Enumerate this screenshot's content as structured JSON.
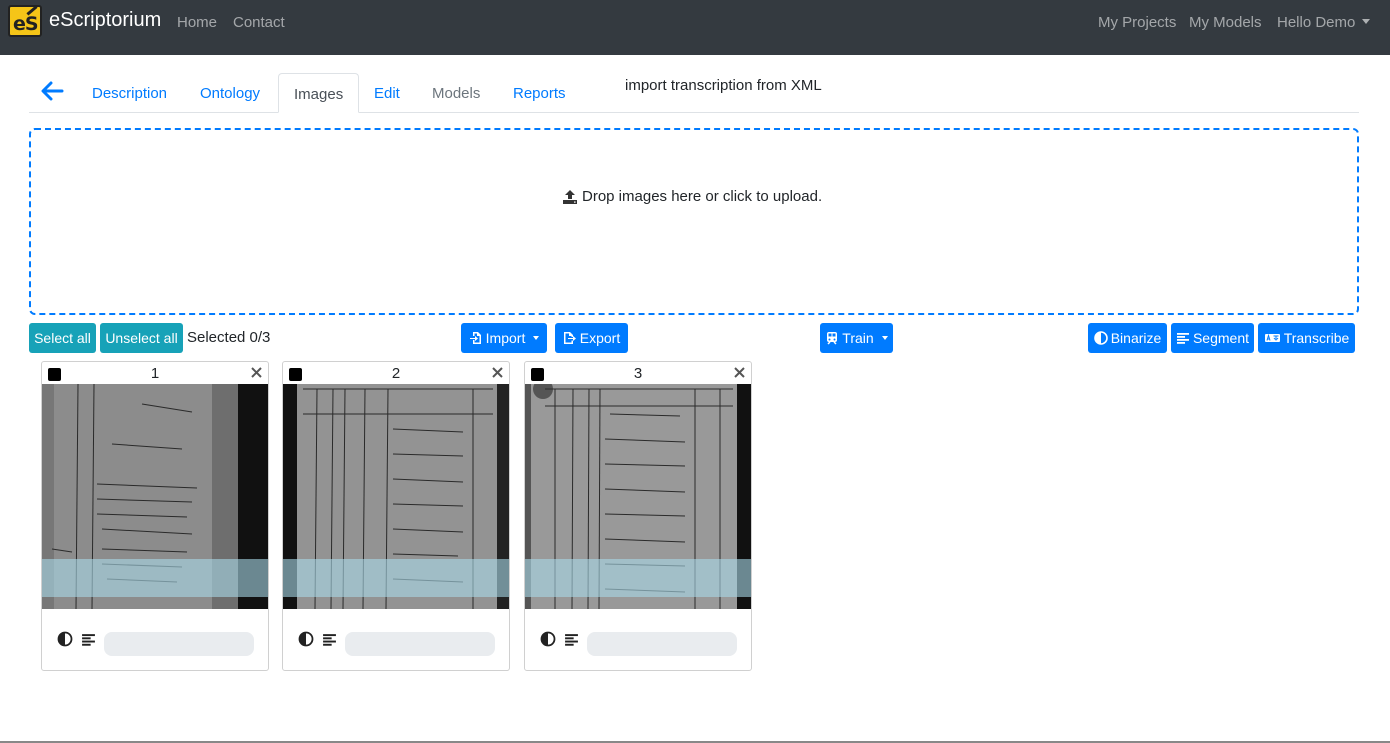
{
  "navbar": {
    "brand": "eScriptorium",
    "logo_text": "eS",
    "links": [
      "Home",
      "Contact"
    ],
    "right_links": [
      "My Projects",
      "My Models"
    ],
    "user_menu": "Hello Demo"
  },
  "tabs": {
    "back_icon": "arrow-left-icon",
    "items": [
      "Description",
      "Ontology",
      "Images",
      "Edit",
      "Models",
      "Reports"
    ],
    "active": "Images",
    "disabled": [
      "Models"
    ],
    "import_xml": "import transcription from XML"
  },
  "dropzone": {
    "icon": "upload-icon",
    "text": "Drop images here or click to upload."
  },
  "toolbar": {
    "select_all": "Select all",
    "unselect_all": "Unselect all",
    "selected": "Selected 0/3",
    "import": "Import",
    "export": "Export",
    "train": "Train",
    "binarize": "Binarize",
    "segment": "Segment",
    "transcribe": "Transcribe"
  },
  "cards": [
    {
      "number": "1"
    },
    {
      "number": "2"
    },
    {
      "number": "3"
    }
  ],
  "colors": {
    "navbar": "#343a40",
    "primary": "#007bff",
    "info": "#17a2b8"
  }
}
